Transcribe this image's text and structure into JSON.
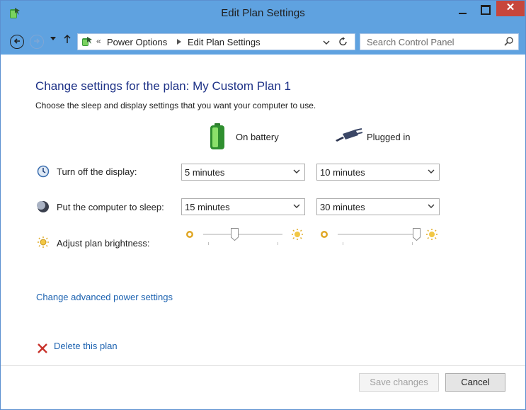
{
  "window": {
    "title": "Edit Plan Settings",
    "close_glyph": "✕"
  },
  "address": {
    "crumb_prefix": "«",
    "crumbs": [
      "Power Options",
      "Edit Plan Settings"
    ],
    "search_placeholder": "Search Control Panel"
  },
  "content": {
    "heading": "Change settings for the plan: My Custom Plan 1",
    "subheading": "Choose the sleep and display settings that you want your computer to use.",
    "columns": [
      "On battery",
      "Plugged in"
    ],
    "rows": [
      {
        "label": "Turn off the display:",
        "battery": "5 minutes",
        "plugged": "10 minutes",
        "icon": "display-icon"
      },
      {
        "label": "Put the computer to sleep:",
        "battery": "15 minutes",
        "plugged": "30 minutes",
        "icon": "moon-icon"
      },
      {
        "label": "Adjust plan brightness:",
        "icon": "sun-icon"
      }
    ],
    "brightness": {
      "battery_level": 0.4,
      "plugged_level": 1.0
    },
    "advanced_link": "Change advanced power settings",
    "delete_link": "Delete this plan"
  },
  "footer": {
    "save_label": "Save changes",
    "cancel_label": "Cancel"
  },
  "colors": {
    "titlebar": "#5fa2e0",
    "heading": "#1e3287",
    "link": "#1c62b0",
    "close": "#c7463c"
  }
}
